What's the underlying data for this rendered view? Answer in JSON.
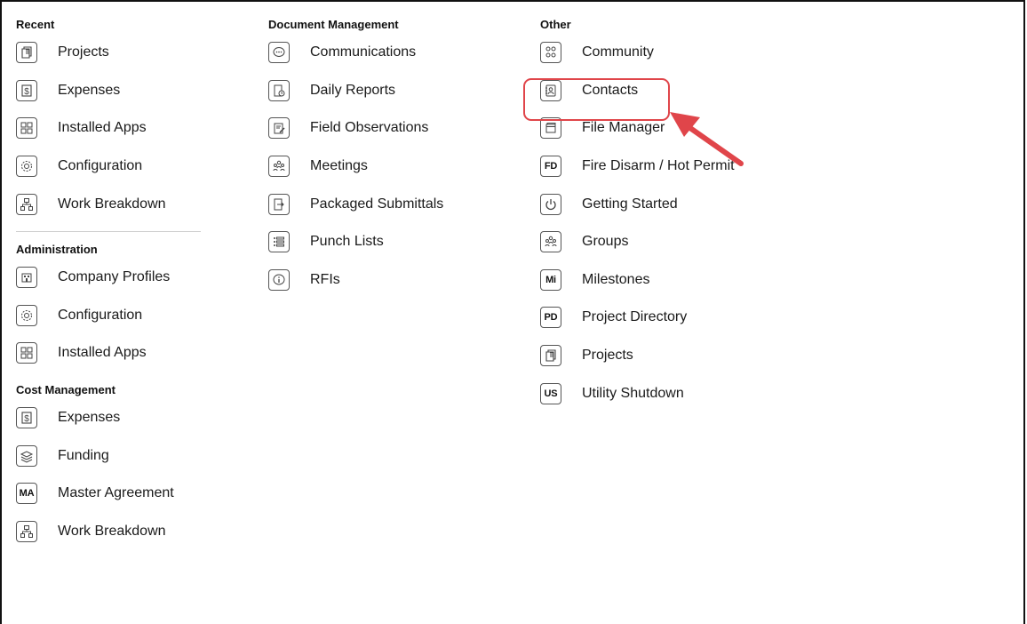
{
  "recent": {
    "title": "Recent",
    "items": [
      {
        "label": "Projects",
        "icon": "projects-icon"
      },
      {
        "label": "Expenses",
        "icon": "dollar-doc-icon"
      },
      {
        "label": "Installed Apps",
        "icon": "installed-apps-icon"
      },
      {
        "label": "Configuration",
        "icon": "gear-icon"
      },
      {
        "label": "Work Breakdown",
        "icon": "hierarchy-icon"
      }
    ]
  },
  "administration": {
    "title": "Administration",
    "items": [
      {
        "label": "Company Profiles",
        "icon": "building-icon"
      },
      {
        "label": "Configuration",
        "icon": "gear-icon"
      },
      {
        "label": "Installed Apps",
        "icon": "installed-apps-icon"
      }
    ]
  },
  "cost_management": {
    "title": "Cost Management",
    "items": [
      {
        "label": "Expenses",
        "icon": "dollar-doc-icon"
      },
      {
        "label": "Funding",
        "icon": "money-stack-icon"
      },
      {
        "label": "Master Agreement",
        "icon_text": "MA"
      },
      {
        "label": "Work Breakdown",
        "icon": "hierarchy-icon"
      }
    ]
  },
  "document_management": {
    "title": "Document Management",
    "items": [
      {
        "label": "Communications",
        "icon": "chat-bubble-icon"
      },
      {
        "label": "Daily Reports",
        "icon": "report-clock-icon"
      },
      {
        "label": "Field Observations",
        "icon": "clipboard-pen-icon"
      },
      {
        "label": "Meetings",
        "icon": "people-group-icon"
      },
      {
        "label": "Packaged Submittals",
        "icon": "submit-doc-icon"
      },
      {
        "label": "Punch Lists",
        "icon": "list-icon"
      },
      {
        "label": "RFIs",
        "icon": "info-bubble-icon"
      }
    ]
  },
  "other": {
    "title": "Other",
    "items": [
      {
        "label": "Community",
        "icon": "community-icon"
      },
      {
        "label": "Contacts",
        "icon": "address-book-icon"
      },
      {
        "label": "File Manager",
        "icon": "folders-icon"
      },
      {
        "label": "Fire Disarm / Hot Permit",
        "icon_text": "FD"
      },
      {
        "label": "Getting Started",
        "icon": "power-icon"
      },
      {
        "label": "Groups",
        "icon": "people-group-icon"
      },
      {
        "label": "Milestones",
        "icon_text": "Mi"
      },
      {
        "label": "Project Directory",
        "icon_text": "PD"
      },
      {
        "label": "Projects",
        "icon": "projects-icon"
      },
      {
        "label": "Utility Shutdown",
        "icon_text": "US"
      }
    ]
  },
  "annotation": {
    "highlight_color": "#e0454a",
    "arrow_color": "#e0454a",
    "highlighted_item": "Contacts"
  }
}
